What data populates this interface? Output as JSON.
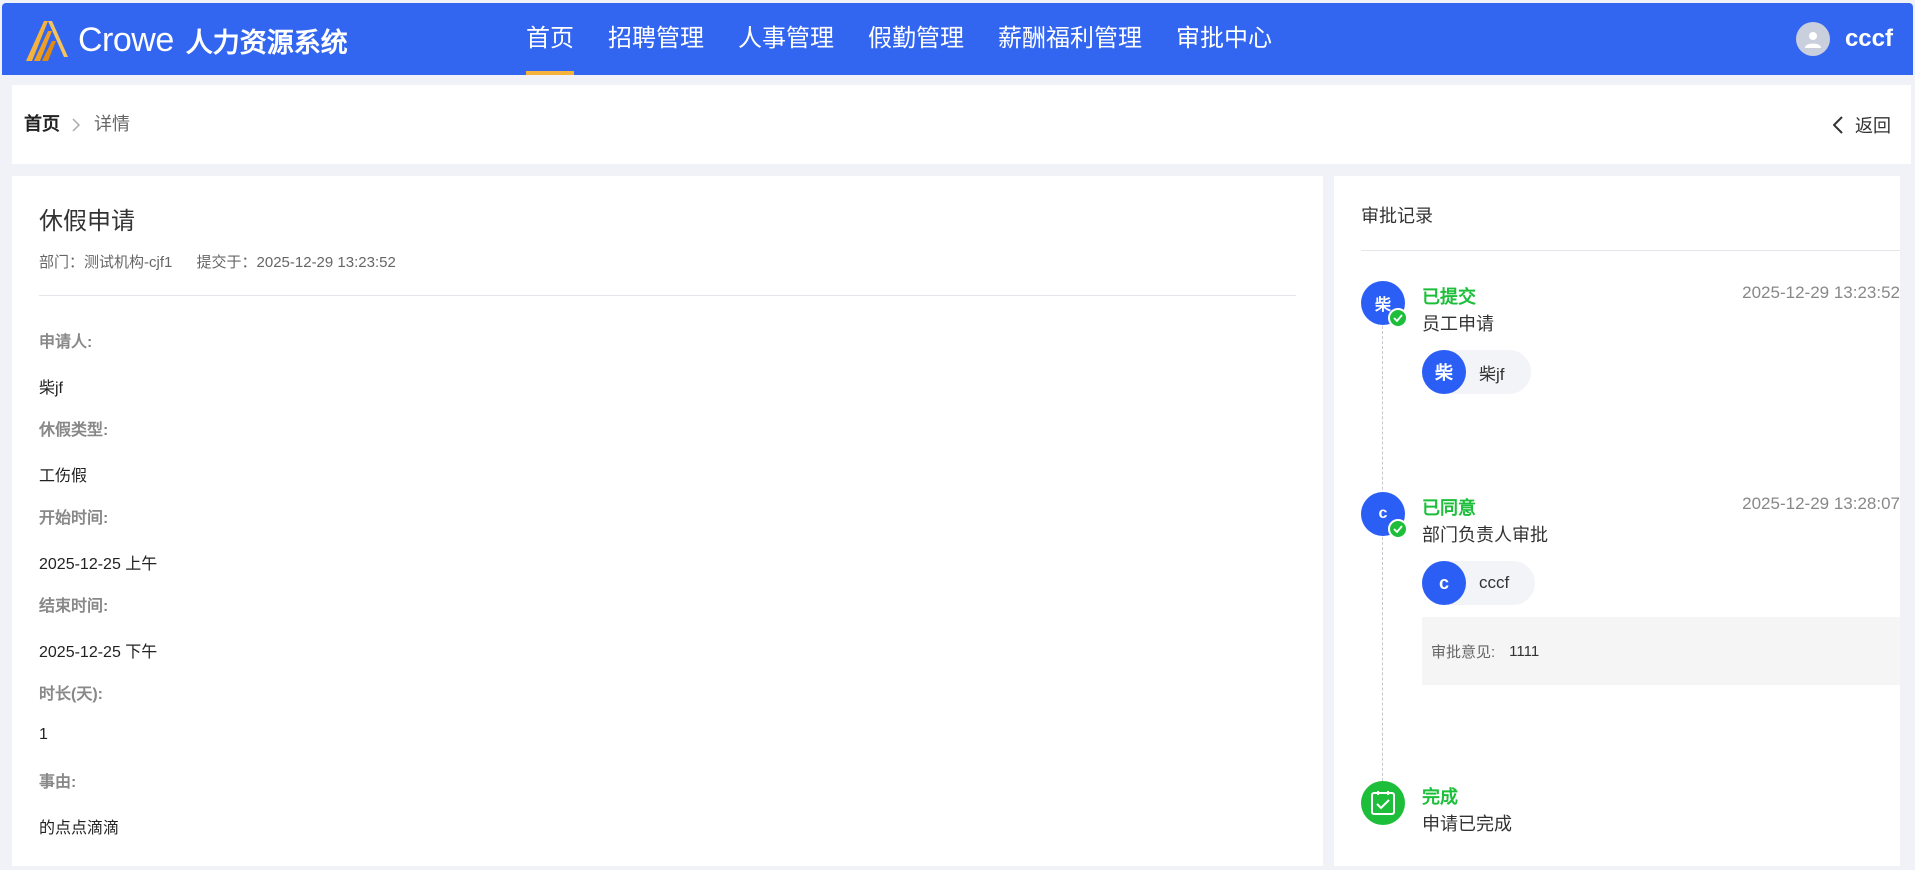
{
  "header": {
    "brand": "Crowe",
    "system_name": "人力资源系统",
    "nav": [
      "首页",
      "招聘管理",
      "人事管理",
      "假勤管理",
      "薪酬福利管理",
      "审批中心"
    ],
    "active_nav": "首页",
    "user_name": "cccf",
    "accent_color": "#3366f0",
    "active_underline_color": "#f5b33b"
  },
  "breadcrumb": {
    "home": "首页",
    "current": "详情",
    "back_label": "返回"
  },
  "detail": {
    "title": "休假申请",
    "department": "部门：测试机构-cjf1",
    "submitted_at": "提交于：2025-12-29 13:23:52",
    "fields": [
      {
        "label": "申请人:",
        "value": "柴jf"
      },
      {
        "label": "休假类型:",
        "value": "工伤假"
      },
      {
        "label": "开始时间:",
        "value": "2025-12-25 上午"
      },
      {
        "label": "结束时间:",
        "value": "2025-12-25 下午"
      },
      {
        "label": "时长(天):",
        "value": "1"
      },
      {
        "label": "事由:",
        "value": "的点点滴滴"
      }
    ]
  },
  "approval": {
    "title": "审批记录",
    "nodes": [
      {
        "avatar": "柴",
        "status": "已提交",
        "time": "2025-12-29 13:23:52",
        "desc": "员工申请",
        "person_avatar": "柴",
        "person_name": "柴jf"
      },
      {
        "avatar": "c",
        "status": "已同意",
        "time": "2025-12-29 13:28:07",
        "desc": "部门负责人审批",
        "person_avatar": "c",
        "person_name": "cccf",
        "opinion_label": "审批意见:",
        "opinion_value": "1111"
      },
      {
        "status": "完成",
        "desc": "申请已完成"
      }
    ],
    "status_color": "#1dbf3a"
  }
}
